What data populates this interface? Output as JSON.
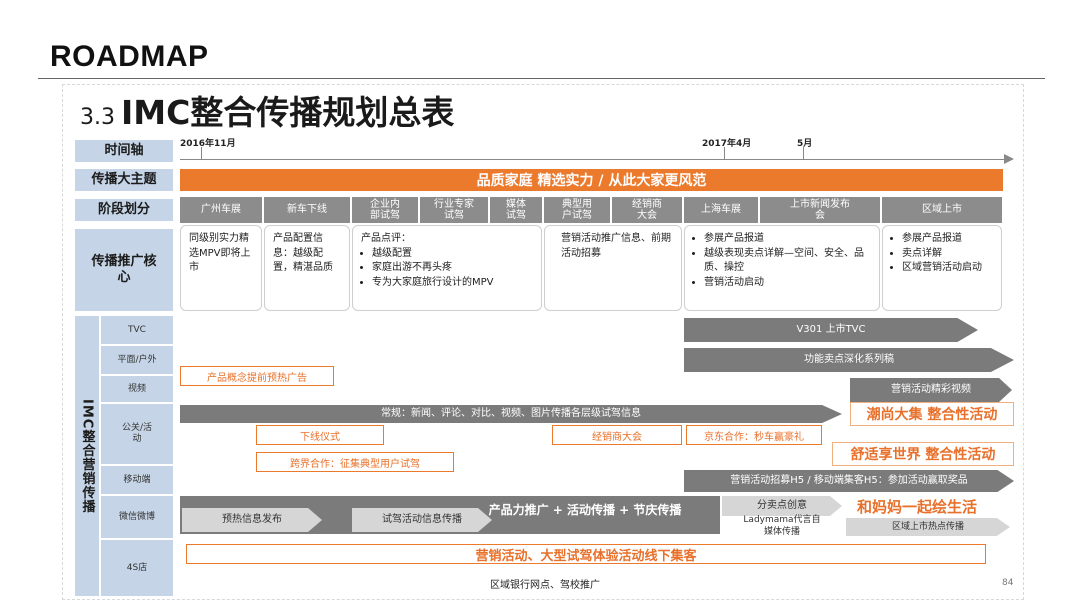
{
  "header": {
    "title": "ROADMAP"
  },
  "slide": {
    "number": "3.3",
    "title": "IMC整合传播规划总表",
    "page": "84"
  },
  "timeline": {
    "ticks": [
      "2016年11月",
      "2017年4月",
      "5月"
    ]
  },
  "rows": {
    "timeline": "时间轴",
    "theme": "传播大主题",
    "stage": "阶段划分",
    "core": "传播推广核心",
    "imc": "IMC整合营销传播",
    "tvc": "TVC",
    "print": "平面/户外",
    "video": "视频",
    "pr": "公关/活动",
    "mobile": "移动端",
    "wechat": "微信微博",
    "store": "4S店"
  },
  "theme_text": "品质家庭 精选实力 / 从此大家更风范",
  "stages": [
    "广州车展",
    "新车下线",
    "企业内部试驾",
    "行业专家试驾",
    "媒体试驾",
    "典型用户试驾",
    "经销商大会",
    "上海车展",
    "上市新闻发布会",
    "区域上市"
  ],
  "core": {
    "c1": "同级别实力精选MPV即将上市",
    "c2": "产品配置信息：越级配置，精湛品质",
    "c3_title": "产品点评：",
    "c3_items": [
      "越级配置",
      "家庭出游不再头疼",
      "专为大家庭旅行设计的MPV"
    ],
    "c4": "营销活动推广信息、前期活动招募",
    "c5_items": [
      "参展产品报道",
      "越级表现卖点详解—空间、安全、品质、操控",
      "营销活动启动"
    ],
    "c6_items": [
      "参展产品报道",
      "卖点详解",
      "区域营销活动启动"
    ]
  },
  "imc": {
    "tvc": "V301 上市TVC",
    "print": "功能卖点深化系列稿",
    "video_pre": "产品概念提前预热广告",
    "video_main": "营销活动精彩视频",
    "pr_bar": "常规：新闻、评论、对比、视频、图片传播各层级试驾信息",
    "pr_big1": "潮尚大集 整合性活动",
    "pr_offline": "下线仪式",
    "pr_dealer": "经销商大会",
    "pr_jd": "京东合作：秒车赢豪礼",
    "pr_big2": "舒适享世界 整合性活动",
    "pr_cross": "跨界合作：征集典型用户试驾",
    "mobile": "营销活动招募H5 / 移动端集客H5：参加活动赢取奖品",
    "wechat_main": "产品力推广 + 活动传播 + 节庆传播",
    "wechat_pre": "预热信息发布",
    "wechat_trial": "试驾活动信息传播",
    "wechat_sell": "分卖点创意",
    "wechat_lady": "Ladymama代言自媒体传播",
    "wechat_big": "和妈妈一起绘生活",
    "wechat_region": "区域上市热点传播",
    "store_main": "营销活动、大型试驾体验活动线下集客",
    "store_sub": "区域银行网点、驾校推广"
  },
  "colors": {
    "orange": "#ec7a2c",
    "label_blue": "#c5d4e6",
    "gray": "#8c8c8c"
  }
}
